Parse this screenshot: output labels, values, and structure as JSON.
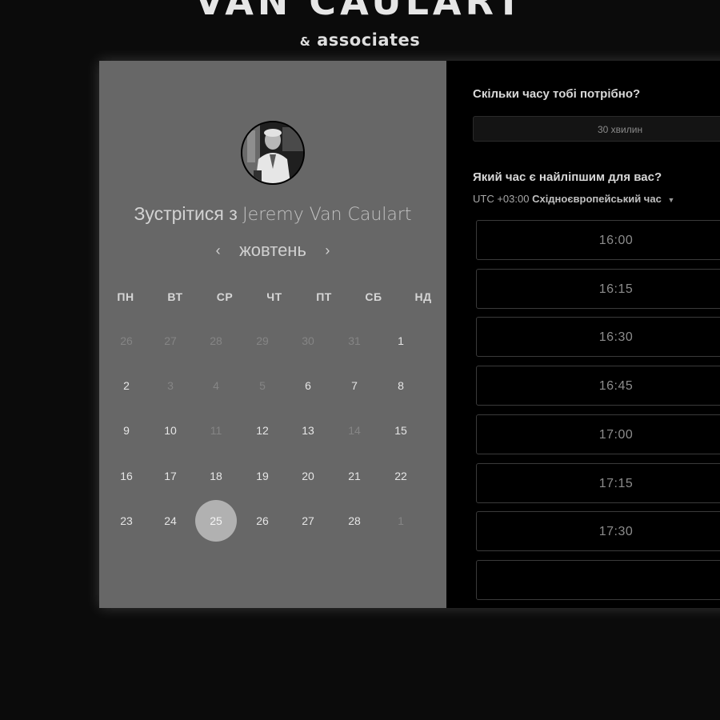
{
  "brand": {
    "title": "VAN CAULART",
    "ampersand": "&",
    "subtitle": "associates"
  },
  "left": {
    "heading_prefix": "Зустрітися з",
    "host_name": "Jeremy Van Caulart",
    "month": "жовтень",
    "prev_icon": "‹",
    "next_icon": "›",
    "weekdays": [
      "ПН",
      "ВТ",
      "СР",
      "ЧТ",
      "ПТ",
      "СБ",
      "НД"
    ],
    "weeks": [
      [
        {
          "d": "26",
          "m": true
        },
        {
          "d": "27",
          "m": true
        },
        {
          "d": "28",
          "m": true
        },
        {
          "d": "29",
          "m": true
        },
        {
          "d": "30",
          "m": true
        },
        {
          "d": "31",
          "m": true
        },
        {
          "d": "1",
          "m": false
        }
      ],
      [
        {
          "d": "2",
          "m": false
        },
        {
          "d": "3",
          "m": true
        },
        {
          "d": "4",
          "m": true
        },
        {
          "d": "5",
          "m": true
        },
        {
          "d": "6",
          "m": false
        },
        {
          "d": "7",
          "m": false
        },
        {
          "d": "8",
          "m": false
        }
      ],
      [
        {
          "d": "9",
          "m": false
        },
        {
          "d": "10",
          "m": false
        },
        {
          "d": "11",
          "m": true
        },
        {
          "d": "12",
          "m": false
        },
        {
          "d": "13",
          "m": false
        },
        {
          "d": "14",
          "m": true
        },
        {
          "d": "15",
          "m": false
        }
      ],
      [
        {
          "d": "16",
          "m": false
        },
        {
          "d": "17",
          "m": false
        },
        {
          "d": "18",
          "m": false
        },
        {
          "d": "19",
          "m": false
        },
        {
          "d": "20",
          "m": false
        },
        {
          "d": "21",
          "m": false
        },
        {
          "d": "22",
          "m": false
        }
      ],
      [
        {
          "d": "23",
          "m": false
        },
        {
          "d": "24",
          "m": false
        },
        {
          "d": "25",
          "m": false,
          "s": true
        },
        {
          "d": "26",
          "m": false
        },
        {
          "d": "27",
          "m": false
        },
        {
          "d": "28",
          "m": false
        },
        {
          "d": "1",
          "m": true
        }
      ]
    ]
  },
  "right": {
    "duration_label": "Скільки часу тобі потрібно?",
    "duration_value": "30 хвилин",
    "time_label": "Який час є найліпшим для вас?",
    "tz_offset": "UTC +03:00",
    "tz_name": "Східноєвропейський час",
    "slots": [
      "16:00",
      "16:15",
      "16:30",
      "16:45",
      "17:00",
      "17:15",
      "17:30"
    ]
  },
  "colors": {
    "left_panel": "#676767",
    "selected_day": "#b1b1b1",
    "right_panel": "#000000"
  }
}
